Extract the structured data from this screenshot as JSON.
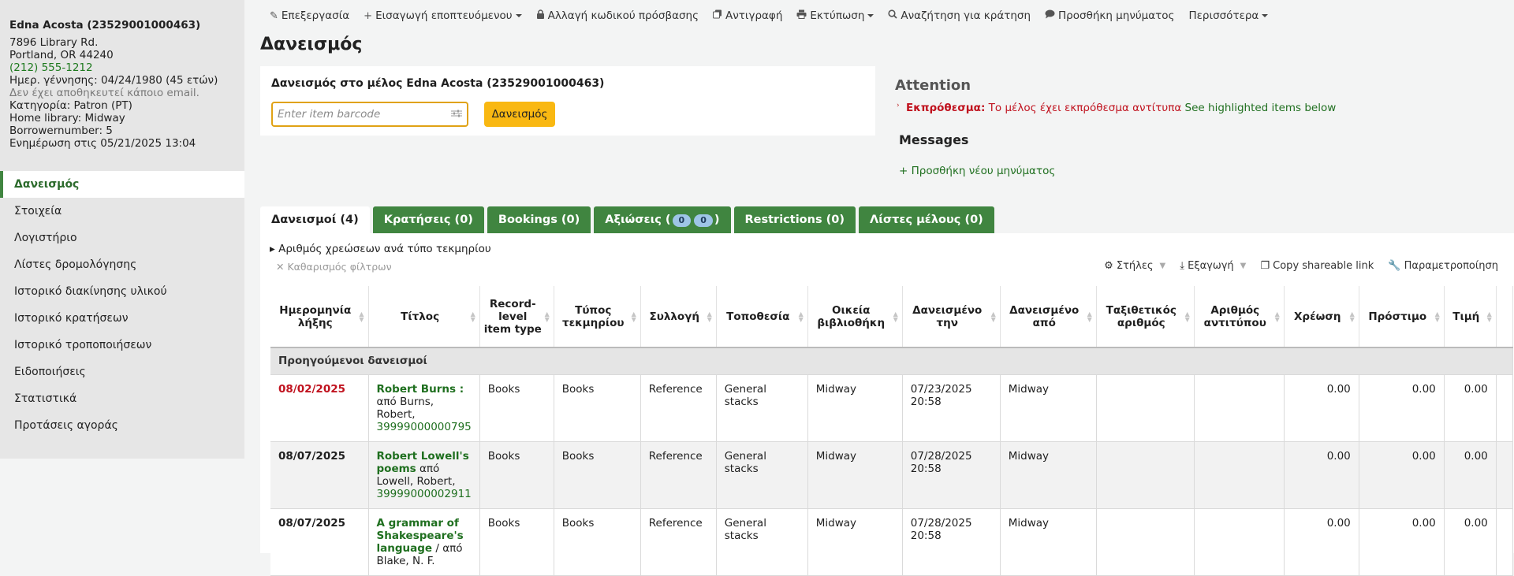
{
  "patron": {
    "name": "Edna Acosta (23529001000463)",
    "address1": "7896 Library Rd.",
    "address2": "Portland, OR 44240",
    "phone": "(212) 555-1212",
    "dob": "Ημερ. γέννησης: 04/24/1980 (45 ετών)",
    "no_email": "Δεν έχει αποθηκευτεί κάποιο email.",
    "category": "Κατηγορία: Patron (PT)",
    "home_library": "Home library: Midway",
    "borrowernumber": "Borrowernumber: 5",
    "updated": "Ενημέρωση στις 05/21/2025 13:04"
  },
  "nav": [
    {
      "label": "Δανεισμός"
    },
    {
      "label": "Στοιχεία"
    },
    {
      "label": "Λογιστήριο"
    },
    {
      "label": "Λίστες δρομολόγησης"
    },
    {
      "label": "Ιστορικό διακίνησης υλικού"
    },
    {
      "label": "Ιστορικό κρατήσεων"
    },
    {
      "label": "Ιστορικό τροποποιήσεων"
    },
    {
      "label": "Ειδοποιήσεις"
    },
    {
      "label": "Στατιστικά"
    },
    {
      "label": "Προτάσεις αγοράς"
    }
  ],
  "toolbar": {
    "edit": "Επεξεργασία",
    "add_guarantor": "Εισαγωγή εποπτευόμενου",
    "change_password": "Αλλαγή κωδικού πρόσβασης",
    "duplicate": "Αντιγραφή",
    "print": "Εκτύπωση",
    "search_hold": "Αναζήτηση για κράτηση",
    "add_message": "Προσθήκη μηνύματος",
    "more": "Περισσότερα"
  },
  "page_title": "Δανεισμός",
  "checkout": {
    "title": "Δανεισμός στο μέλος Edna Acosta (23529001000463)",
    "placeholder": "Enter item barcode",
    "button": "Δανεισμός"
  },
  "attention": {
    "heading": "Attention",
    "overdue_label": "Εκπρόθεσμα:",
    "overdue_text": "Το μέλος έχει εκπρόθεσμα αντίτυπα",
    "overdue_link": "See highlighted items below"
  },
  "messages": {
    "heading": "Messages",
    "add_new": "Προσθήκη νέου μηνύματος"
  },
  "tabs": {
    "checkouts": "Δανεισμοί (4)",
    "holds": "Κρατήσεις (0)",
    "bookings": "Bookings (0)",
    "claims_prefix": "Αξιώσεις (",
    "claims_a": "0",
    "claims_b": "0",
    "claims_suffix": ")",
    "restrictions": "Restrictions (0)",
    "patron_lists": "Λίστες μέλους (0)"
  },
  "panel": {
    "summary": "Αριθμός χρεώσεων ανά τύπο τεκμηρίου",
    "clear_filters": "Καθαρισμός φίλτρων",
    "columns": "Στήλες",
    "export": "Εξαγωγή",
    "copy_link": "Copy shareable link",
    "configure": "Παραμετροποίηση"
  },
  "table": {
    "headers": [
      "Ημερομηνία λήξης",
      "Τίτλος",
      "Record-level item type",
      "Τύπος τεκμηρίου",
      "Συλλογή",
      "Τοποθεσία",
      "Οικεία βιβλιοθήκη",
      "Δανεισμένο την",
      "Δανεισμένο από",
      "Ταξιθετικός αριθμός",
      "Αριθμός αντιτύπου",
      "Χρέωση",
      "Πρόστιμο",
      "Τιμή"
    ],
    "group_label": "Προηγούμενοι δανεισμοί",
    "rows": [
      {
        "due": "08/02/2025",
        "title": "Robert Burns :",
        "by": "από Burns, Robert,",
        "barcode": "39999000000795",
        "rl_type": "Books",
        "itype": "Books",
        "collection": "Reference",
        "location": "General stacks",
        "home": "Midway",
        "issued_on": "07/23/2025 20:58",
        "issued_from": "Midway",
        "callnum": "",
        "copy": "",
        "charge": "0.00",
        "fine": "0.00",
        "price": "0.00"
      },
      {
        "due": "08/07/2025",
        "title": "Robert Lowell's poems",
        "by": "από Lowell, Robert,",
        "barcode": "39999000002911",
        "rl_type": "Books",
        "itype": "Books",
        "collection": "Reference",
        "location": "General stacks",
        "home": "Midway",
        "issued_on": "07/28/2025 20:58",
        "issued_from": "Midway",
        "callnum": "",
        "copy": "",
        "charge": "0.00",
        "fine": "0.00",
        "price": "0.00"
      },
      {
        "due": "08/07/2025",
        "title": "A grammar of Shakespeare's language",
        "by": "/ από Blake, N. F.",
        "barcode": "",
        "rl_type": "Books",
        "itype": "Books",
        "collection": "Reference",
        "location": "General stacks",
        "home": "Midway",
        "issued_on": "07/28/2025 20:58",
        "issued_from": "Midway",
        "callnum": "",
        "copy": "",
        "charge": "0.00",
        "fine": "0.00",
        "price": "0.00"
      }
    ]
  }
}
